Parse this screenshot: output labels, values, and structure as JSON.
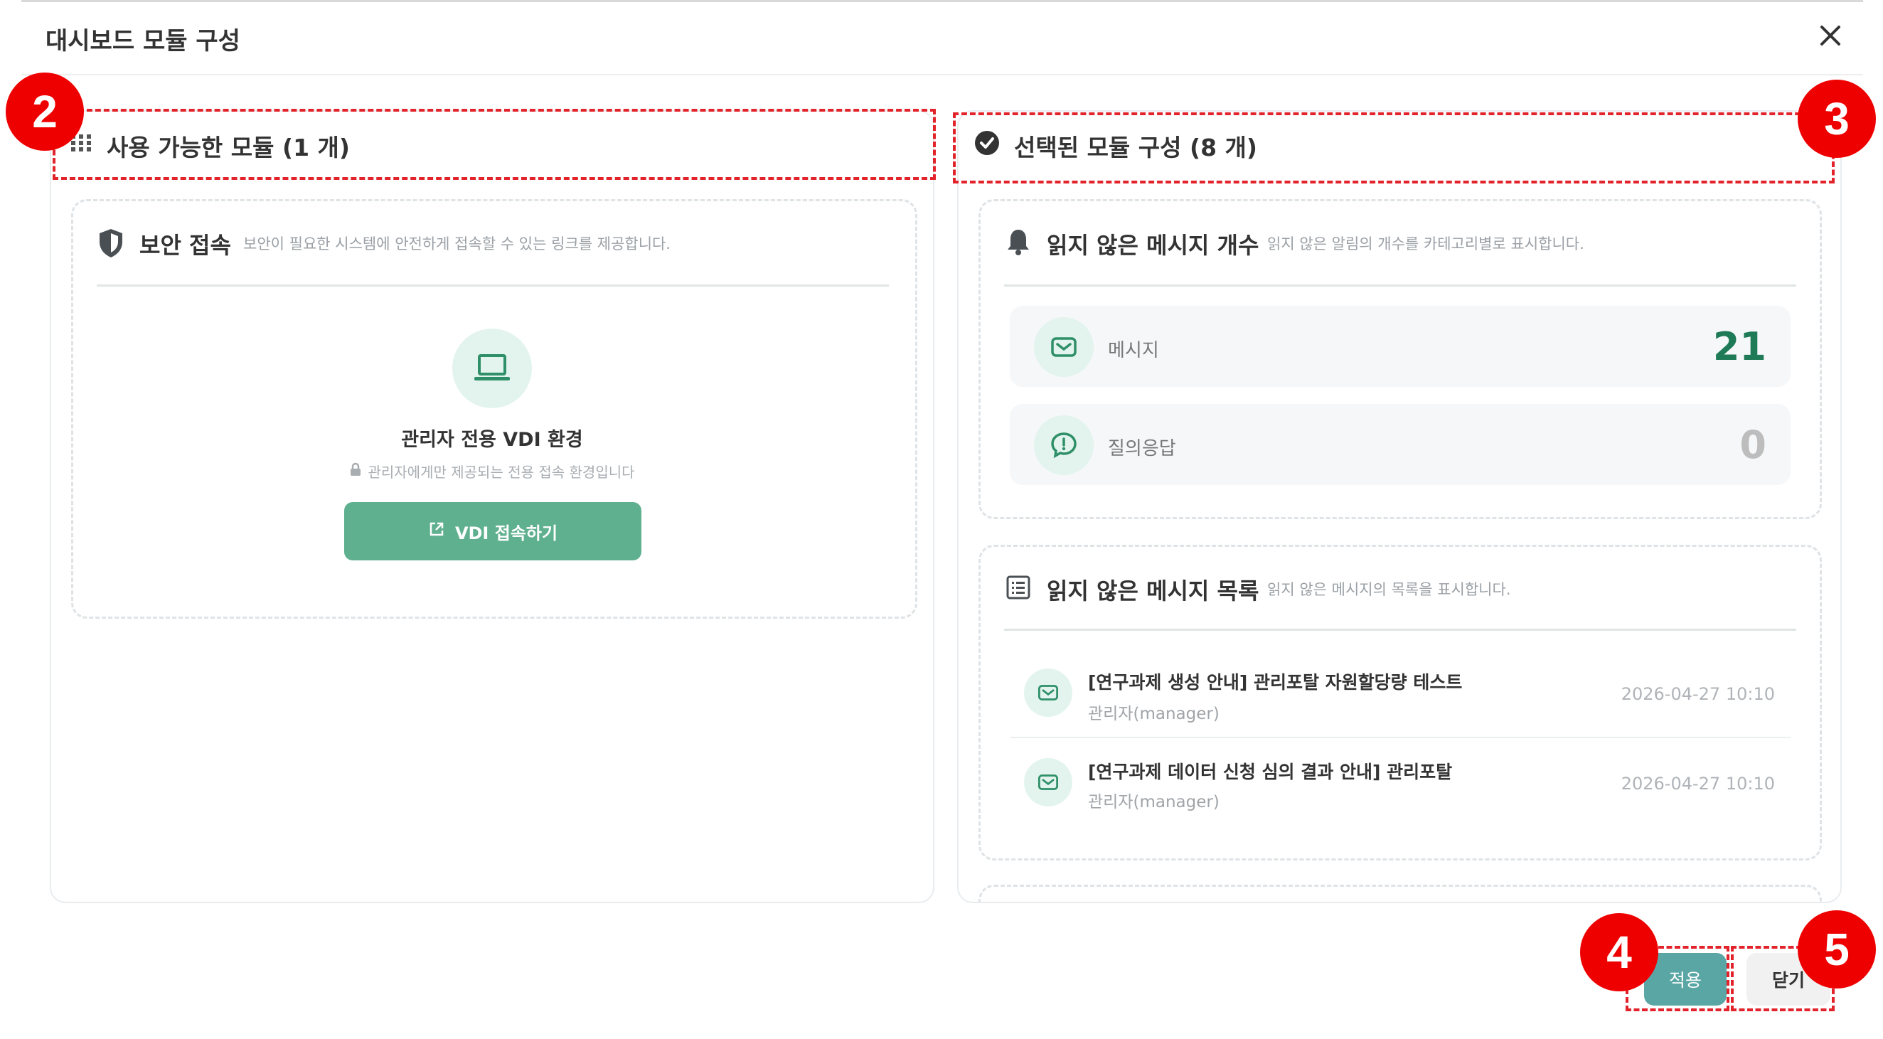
{
  "dialog": {
    "title": "대시보드 모듈 구성",
    "close_icon": "close-icon"
  },
  "available": {
    "header": "사용 가능한 모듈 (1 개)",
    "icon": "grid-icon",
    "card": {
      "title": "보안 접속",
      "description": "보안이 필요한 시스템에 안전하게 접속할 수 있는 링크를 제공합니다.",
      "icon": "shield-icon",
      "item_title": "관리자 전용 VDI 환경",
      "item_note": "관리자에게만 제공되는 전용 접속 환경입니다",
      "button_label": "VDI 접속하기"
    }
  },
  "selected": {
    "header": "선택된 모듈 구성 (8 개)",
    "icon": "check-circle-icon",
    "unread_count": {
      "title": "읽지 않은 메시지 개수",
      "description": "읽지 않은 알림의 개수를 카테고리별로 표시합니다.",
      "rows": [
        {
          "label": "메시지",
          "value": "21",
          "icon": "mail-icon"
        },
        {
          "label": "질의응답",
          "value": "0",
          "icon": "alert-message-icon"
        }
      ]
    },
    "unread_list": {
      "title": "읽지 않은 메시지 목록",
      "description": "읽지 않은 메시지의 목록을 표시합니다.",
      "items": [
        {
          "title": "[연구과제 생성 안내] 관리포탈 자원할당량 테스트",
          "sender": "관리자(manager)",
          "date": "2026-04-27 10:10"
        },
        {
          "title": "[연구과제 데이터 신청 심의 결과 안내] 관리포탈",
          "sender": "관리자(manager)",
          "date": "2026-04-27 10:10"
        }
      ]
    }
  },
  "footer": {
    "apply_label": "적용",
    "close_label": "닫기"
  },
  "badges": [
    "2",
    "3",
    "4",
    "5"
  ],
  "colors": {
    "accent_green": "#5fb08f",
    "metric_green": "#1f7a57",
    "badge_red": "#ee0000",
    "apply_teal": "#5aa6a4"
  }
}
